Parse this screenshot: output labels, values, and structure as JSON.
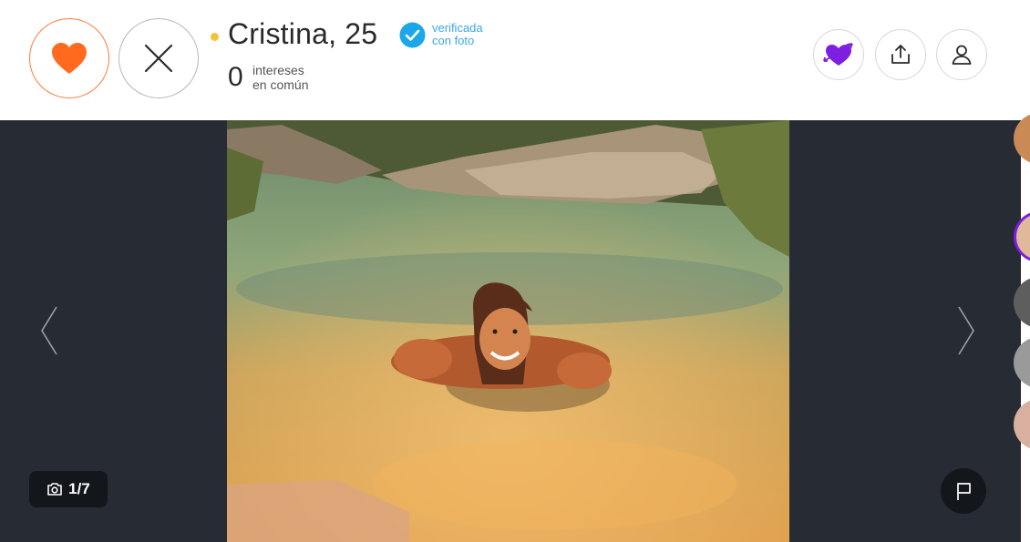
{
  "header": {
    "name": "Cristina, 25",
    "verified_label_line1": "verificada",
    "verified_label_line2": "con foto",
    "common_interests_count": "0",
    "common_interests_line1": "intereses",
    "common_interests_line2": "en común"
  },
  "actions": {
    "like": "heart-icon",
    "dislike": "close-icon",
    "crush": "heart-arrow-icon",
    "share": "share-icon",
    "profile": "user-icon"
  },
  "viewer": {
    "photo_counter": "1/7",
    "current_photo": 1,
    "total_photos": 7
  },
  "colors": {
    "accent_orange": "#ff6a1f",
    "crush_purple": "#7d1ee0",
    "verified_blue": "#1ea7e8",
    "online_yellow": "#f7c23a",
    "viewer_bg": "#272b33"
  }
}
